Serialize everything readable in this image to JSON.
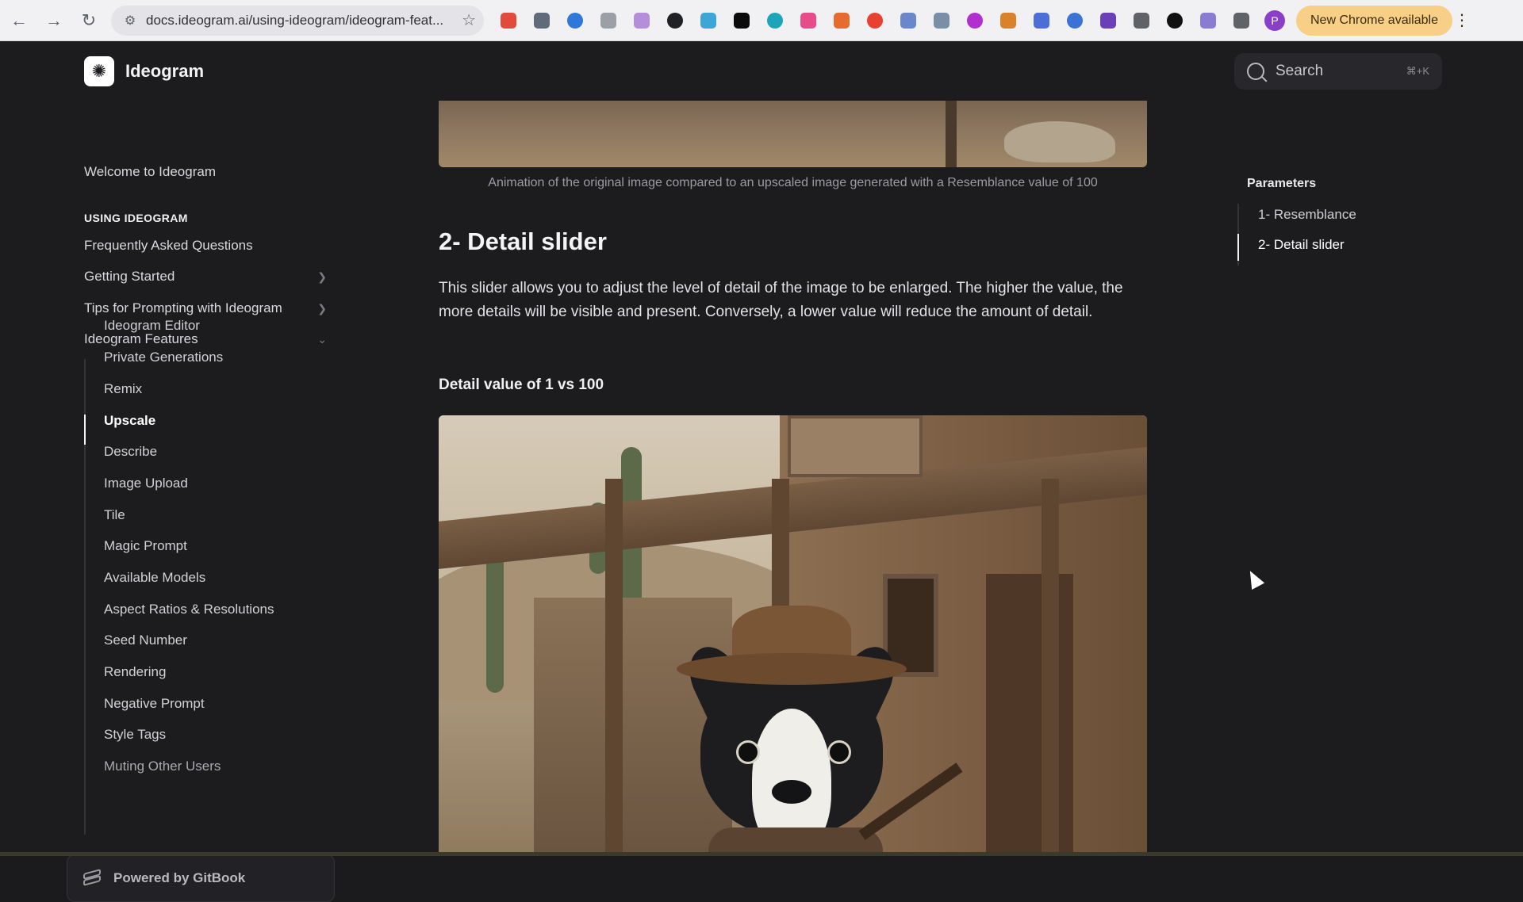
{
  "browser": {
    "url": "docs.ideogram.ai/using-ideogram/ideogram-feat...",
    "update_label": "New Chrome available",
    "profile_initial": "P",
    "icons": [
      "back-icon",
      "forward-icon",
      "reload-icon",
      "site-settings-icon",
      "bookmark-star-icon",
      "downloads-icon",
      "extensions-icon",
      "more-icon"
    ],
    "extension_colors": [
      "#e24a3b",
      "#5f6b7a",
      "#2d78d8",
      "#9aa0a6",
      "#b58ddb",
      "#202124",
      "#3ea6d6",
      "#0b0b0b",
      "#1ca5b8",
      "#e84b8a",
      "#e66b2e",
      "#e8412f",
      "#6a88c9",
      "#7a8ea8",
      "#b22fcf",
      "#d9822b",
      "#4b6fd6",
      "#3a73d4",
      "#6b3fb8",
      "#5f6368",
      "#111111",
      "#8a7bd3",
      "#5f6368"
    ]
  },
  "site": {
    "brand": "Ideogram",
    "search_placeholder": "Search",
    "search_shortcut": "⌘+K"
  },
  "sidebar": {
    "welcome": "Welcome to Ideogram",
    "section": "USING IDEOGRAM",
    "faq": "Frequently Asked Questions",
    "getting_started": "Getting Started",
    "tips": "Tips for Prompting with Ideogram",
    "features": "Ideogram Features",
    "sub_items": [
      "Ideogram Editor",
      "Private Generations",
      "Remix",
      "Upscale",
      "Describe",
      "Image Upload",
      "Tile",
      "Magic Prompt",
      "Available Models",
      "Aspect Ratios & Resolutions",
      "Seed Number",
      "Rendering",
      "Negative Prompt",
      "Style Tags",
      "Muting Other Users"
    ],
    "active_item": "Upscale",
    "powered_by": "Powered by GitBook"
  },
  "content": {
    "caption": "Animation of the original image compared to an upscaled image generated with a Resemblance value of 100",
    "heading": "2- Detail slider",
    "paragraph": "This slider allows you to adjust the level of detail of the image to be enlarged. The higher the value, the more details will be visible and present. Conversely, a lower value will reduce the amount of detail.",
    "subheading": "Detail value of 1 vs 100"
  },
  "toc": {
    "title": "Parameters",
    "items": [
      "1- Resemblance",
      "2- Detail slider"
    ],
    "active": "2- Detail slider"
  }
}
